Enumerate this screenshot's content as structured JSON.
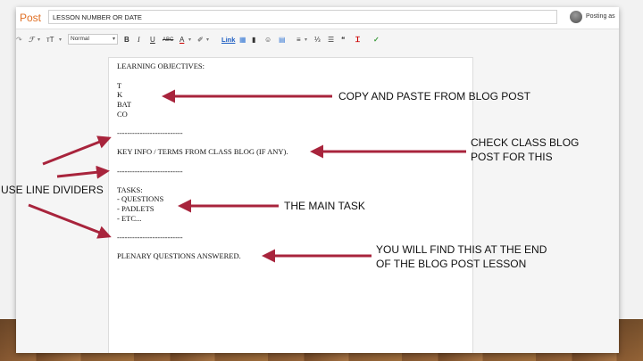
{
  "app": {
    "post_label": "Post"
  },
  "title_field": {
    "value": "LESSON NUMBER OR DATE"
  },
  "account": {
    "posting_as": "Posting as"
  },
  "toolbar": {
    "undo": "↷",
    "font": "ℱ",
    "size": "тT",
    "style_value": "Normal",
    "bold": "B",
    "italic": "I",
    "underline": "U",
    "strike": "ABC",
    "text_color": "A",
    "highlight": "✐",
    "link": "Link",
    "image": "▦",
    "video": "▮",
    "emoji": "☺",
    "jump": "▤",
    "align": "≡",
    "numbered": "⅓",
    "bullets": "☰",
    "quote": "❝",
    "clear": "Ꮖ",
    "spell": "✓"
  },
  "editor_lines": {
    "objectives": "LEARNING OBJECTIVES:",
    "t": "T",
    "k": "K",
    "bat": "BAT",
    "co": "CO",
    "divider1": "--------------------------",
    "key_info": "KEY INFO / TERMS FROM CLASS BLOG (IF ANY).",
    "divider2": "--------------------------",
    "tasks": "TASKS:",
    "questions": "- QUESTIONS",
    "padlets": "- PADLETS",
    "etc": "- ETC...",
    "divider3": "--------------------------",
    "plenary": "PLENARY QUESTIONS ANSWERED."
  },
  "annotations": {
    "copy_paste": "COPY AND PASTE FROM BLOG POST",
    "check_blog_1": "CHECK CLASS BLOG",
    "check_blog_2": "POST FOR THIS",
    "line_dividers": "USE LINE DIVIDERS",
    "main_task": "THE MAIN TASK",
    "end_of_post_1": "YOU WILL FIND THIS AT THE END",
    "end_of_post_2": "OF THE BLOG POST LESSON"
  },
  "colors": {
    "arrow": "#a8243c",
    "accent": "#e06f24",
    "link": "#1f5fc4"
  }
}
